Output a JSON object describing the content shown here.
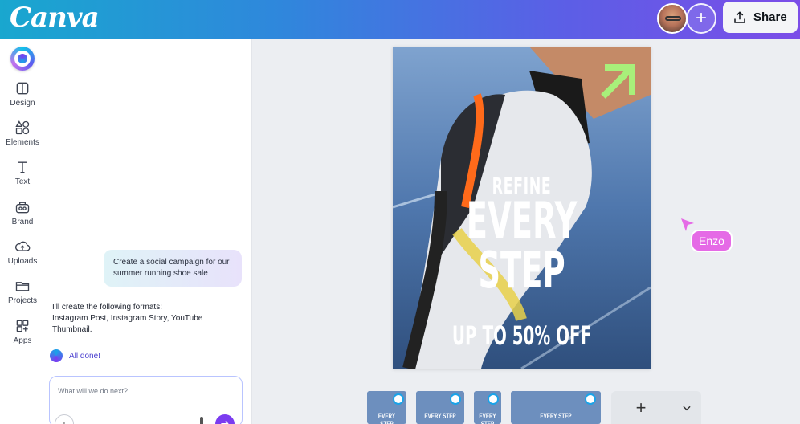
{
  "app": {
    "logo_text": "Canva"
  },
  "topbar": {
    "share_label": "Share",
    "brand_gradient": [
      "#19a7cf",
      "#7b4de8"
    ]
  },
  "rail": {
    "items": [
      {
        "label": "Design",
        "icon": "design-icon"
      },
      {
        "label": "Elements",
        "icon": "elements-icon"
      },
      {
        "label": "Text",
        "icon": "text-icon"
      },
      {
        "label": "Brand",
        "icon": "brand-icon"
      },
      {
        "label": "Uploads",
        "icon": "uploads-icon"
      },
      {
        "label": "Projects",
        "icon": "projects-icon"
      },
      {
        "label": "Apps",
        "icon": "apps-icon"
      }
    ]
  },
  "chat": {
    "user_message": "Create a social campaign for our summer running shoe sale",
    "assistant_reply_intro": "I'll create the following formats:",
    "assistant_reply_formats": "Instagram Post, Instagram Story, YouTube Thumbnail.",
    "status": "All done!",
    "input_placeholder": "What will we do next?"
  },
  "design": {
    "headline_small": "REFINE",
    "headline_large": "EVERY STEP",
    "offer": "UP TO 50% OFF",
    "arrow_color": "#a8f07a"
  },
  "collaborator": {
    "name": "Enzo",
    "color": "#e56ae6"
  },
  "pages": {
    "thumb_text": "EVERY STEP"
  }
}
